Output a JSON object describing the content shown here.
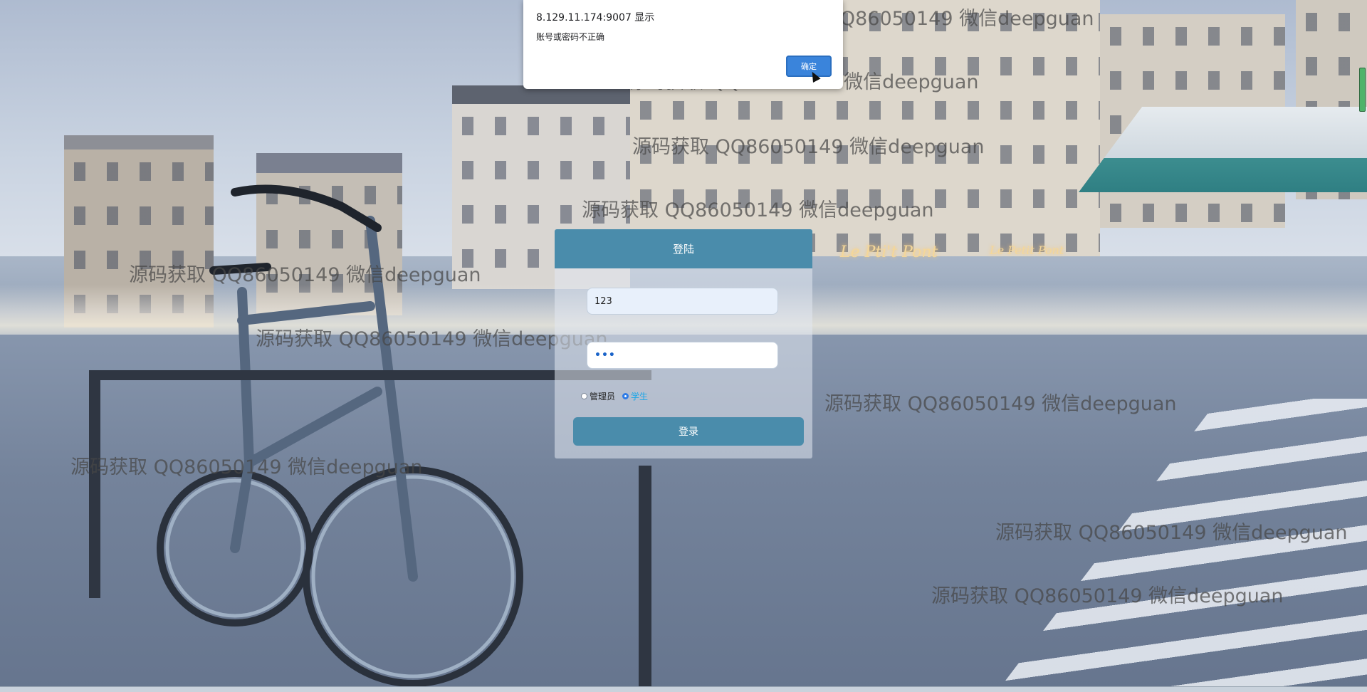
{
  "alert": {
    "origin": "8.129.11.174:9007 显示",
    "message": "账号或密码不正确",
    "ok_label": "确定"
  },
  "login": {
    "title": "登陆",
    "username_value": "123",
    "password_mask": "•••",
    "roles": [
      {
        "label": "管理员",
        "checked": false
      },
      {
        "label": "学生",
        "checked": true
      }
    ],
    "submit_label": "登录"
  },
  "background": {
    "cafe_sign": "Le Pti't Pont",
    "cafe_sign_small": "Le Petit Pont"
  },
  "watermarks": [
    "源码获取 QQ86050149 微信deepguan",
    "源码获取 QQ86050149 微信deepguan",
    "源码获取 QQ86050149 微信deepguan",
    "源码获取 QQ86050149 微信deepguan",
    "源码获取 QQ86050149 微信deepguan",
    "源码获取 QQ86050149 微信deepguan",
    "源码获取 QQ86050149 微信deepguan",
    "源码获取 QQ86050149 微信deepguan",
    "源码获取 QQ86050149 微信deepguan",
    "源码获取 QQ86050149 微信deepguan"
  ],
  "colors": {
    "header_blue": "#4a8cab",
    "alert_button_blue": "#3a84db",
    "student_label_cyan": "#1aa6e8"
  }
}
